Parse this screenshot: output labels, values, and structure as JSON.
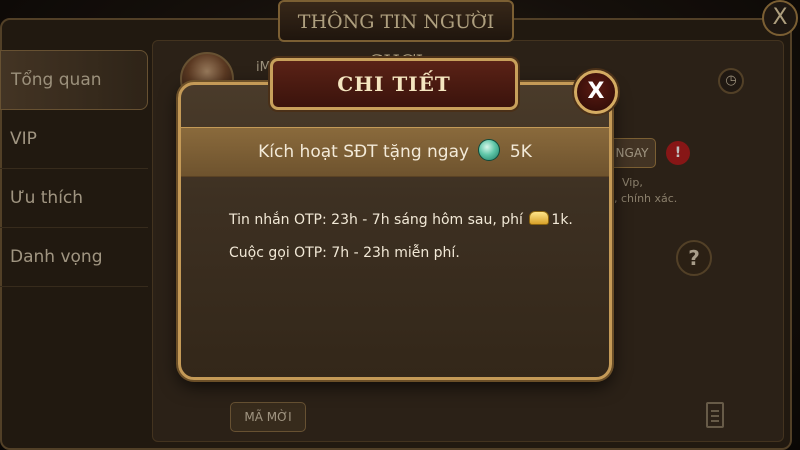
{
  "background_panel": {
    "title": "THÔNG TIN NGƯỜI CHƠI",
    "close_label": "X",
    "menu": [
      {
        "label": "Tổng quan",
        "active": true
      },
      {
        "label": "VIP",
        "active": false
      },
      {
        "label": "Ưu thích",
        "active": false
      },
      {
        "label": "Danh vọng",
        "active": false
      }
    ],
    "partial_name": "iM",
    "activate_button_label": "NGAY",
    "warning_label": "!",
    "help_label": "?",
    "side_text_1": "Vip,",
    "side_text_2": ", chính xác.",
    "invite_button_label": "MÃ MỜI"
  },
  "dialog": {
    "title": "CHI TIẾT",
    "close_label": "X",
    "banner": {
      "text_before": "Kích hoạt SĐT tặng ngay",
      "reward_icon": "gem-icon",
      "reward_amount": "5K"
    },
    "lines": {
      "sms_before": "Tin nhắn OTP: 23h - 7h sáng hôm sau, phí",
      "sms_icon": "gold-coin-icon",
      "sms_amount": "1k.",
      "call": "Cuộc gọi OTP: 7h - 23h miễn phí."
    }
  },
  "colors": {
    "dialog_border": "#c49a57",
    "title_bg": "#5a2216",
    "banner_bg": "#8a6a3c"
  }
}
